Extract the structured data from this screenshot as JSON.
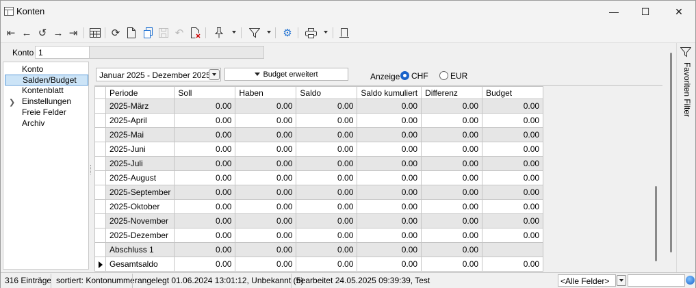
{
  "window": {
    "title": "Konten",
    "minimize_glyph": "—",
    "maximize_glyph": "☐",
    "close_glyph": "✕"
  },
  "toolbar": {
    "icons": [
      "first-record-icon",
      "previous-record-icon",
      "history-icon",
      "next-record-icon",
      "last-record-icon",
      "table-view-icon",
      "refresh-icon",
      "new-document-icon",
      "copy-icon",
      "save-icon",
      "undo-icon",
      "delete-icon",
      "pin-icon",
      "filter-icon",
      "settings-icon",
      "print-icon",
      "layout-icon"
    ]
  },
  "konto": {
    "label": "Konto",
    "value": "1",
    "name": ""
  },
  "nav": {
    "items": [
      {
        "label": "Konto"
      },
      {
        "label": "Salden/Budget",
        "selected": true
      },
      {
        "label": "Kontenblatt"
      },
      {
        "label": "Einstellungen",
        "expandable": true
      },
      {
        "label": "Freie Felder"
      },
      {
        "label": "Archiv"
      }
    ]
  },
  "controls": {
    "period": "Januar 2025 - Dezember 2025",
    "budget_button": "Budget erweitert",
    "anzeige_label": "Anzeige",
    "currency_options": [
      "CHF",
      "EUR"
    ],
    "currency_selected": "CHF"
  },
  "grid": {
    "columns": [
      "Periode",
      "Soll",
      "Haben",
      "Saldo",
      "Saldo kumuliert",
      "Differenz",
      "Budget"
    ],
    "rows": [
      [
        "2025-März",
        "0.00",
        "0.00",
        "0.00",
        "0.00",
        "0.00",
        "0.00"
      ],
      [
        "2025-April",
        "0.00",
        "0.00",
        "0.00",
        "0.00",
        "0.00",
        "0.00"
      ],
      [
        "2025-Mai",
        "0.00",
        "0.00",
        "0.00",
        "0.00",
        "0.00",
        "0.00"
      ],
      [
        "2025-Juni",
        "0.00",
        "0.00",
        "0.00",
        "0.00",
        "0.00",
        "0.00"
      ],
      [
        "2025-Juli",
        "0.00",
        "0.00",
        "0.00",
        "0.00",
        "0.00",
        "0.00"
      ],
      [
        "2025-August",
        "0.00",
        "0.00",
        "0.00",
        "0.00",
        "0.00",
        "0.00"
      ],
      [
        "2025-September",
        "0.00",
        "0.00",
        "0.00",
        "0.00",
        "0.00",
        "0.00"
      ],
      [
        "2025-Oktober",
        "0.00",
        "0.00",
        "0.00",
        "0.00",
        "0.00",
        "0.00"
      ],
      [
        "2025-November",
        "0.00",
        "0.00",
        "0.00",
        "0.00",
        "0.00",
        "0.00"
      ],
      [
        "2025-Dezember",
        "0.00",
        "0.00",
        "0.00",
        "0.00",
        "0.00",
        "0.00"
      ],
      [
        "Abschluss 1",
        "0.00",
        "0.00",
        "0.00",
        "0.00",
        "0.00",
        ""
      ],
      [
        "Gesamtsaldo",
        "0.00",
        "0.00",
        "0.00",
        "0.00",
        "0.00",
        "0.00"
      ]
    ],
    "current_row": 11
  },
  "right_panel": {
    "label": "Favoriten Filter"
  },
  "status": {
    "count": "316 Einträge",
    "sorted": "sortiert: Kontonummer",
    "created": "angelegt 01.06.2024 13:01:12, Unbekannt (5)",
    "edited": "bearbeitet 24.05.2025 09:39:39, Test",
    "field_filter": "<Alle Felder>",
    "search_value": ""
  }
}
